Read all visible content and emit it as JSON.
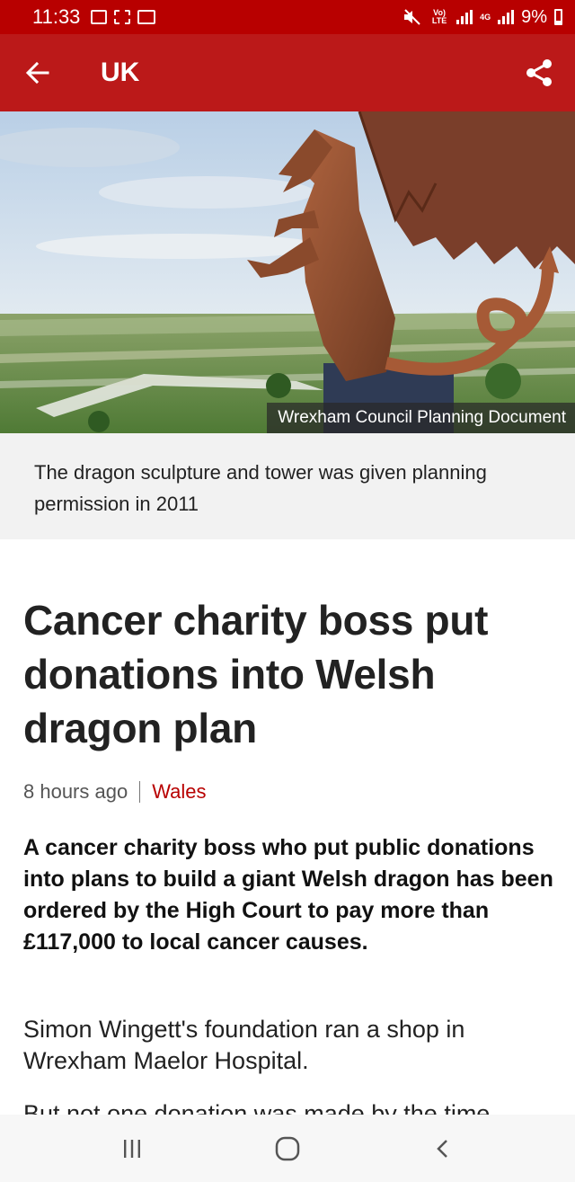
{
  "status_bar": {
    "time": "11:33",
    "network_label": "Vo) LTE",
    "network_4g": "4G",
    "battery": "9%",
    "icons": [
      "image-icon",
      "gallery-icon",
      "voicemail-icon",
      "mute-icon",
      "signal-icon",
      "battery-icon"
    ]
  },
  "app_bar": {
    "title": "UK",
    "back_icon": "arrow-left-icon",
    "share_icon": "share-icon"
  },
  "article": {
    "image_credit": "Wrexham Council Planning Document",
    "image_caption": "The dragon sculpture and tower was given planning permission in 2011",
    "headline": "Cancer charity boss put donations into Welsh dragon plan",
    "time": "8 hours ago",
    "topic": "Wales",
    "intro": "A cancer charity boss who put public donations into plans to build a giant Welsh dragon has been ordered by the High Court to pay more than £117,000 to local cancer causes.",
    "paragraph_1": "Simon Wingett's foundation ran a shop in Wrexham Maelor Hospital.",
    "paragraph_2": "But not one donation was made by the time"
  },
  "nav_bar": {
    "icons": [
      "recent-apps-icon",
      "home-icon",
      "back-icon"
    ]
  },
  "colors": {
    "status_bar": "#b80000",
    "app_bar": "#bb1919",
    "topic_link": "#b80000"
  }
}
